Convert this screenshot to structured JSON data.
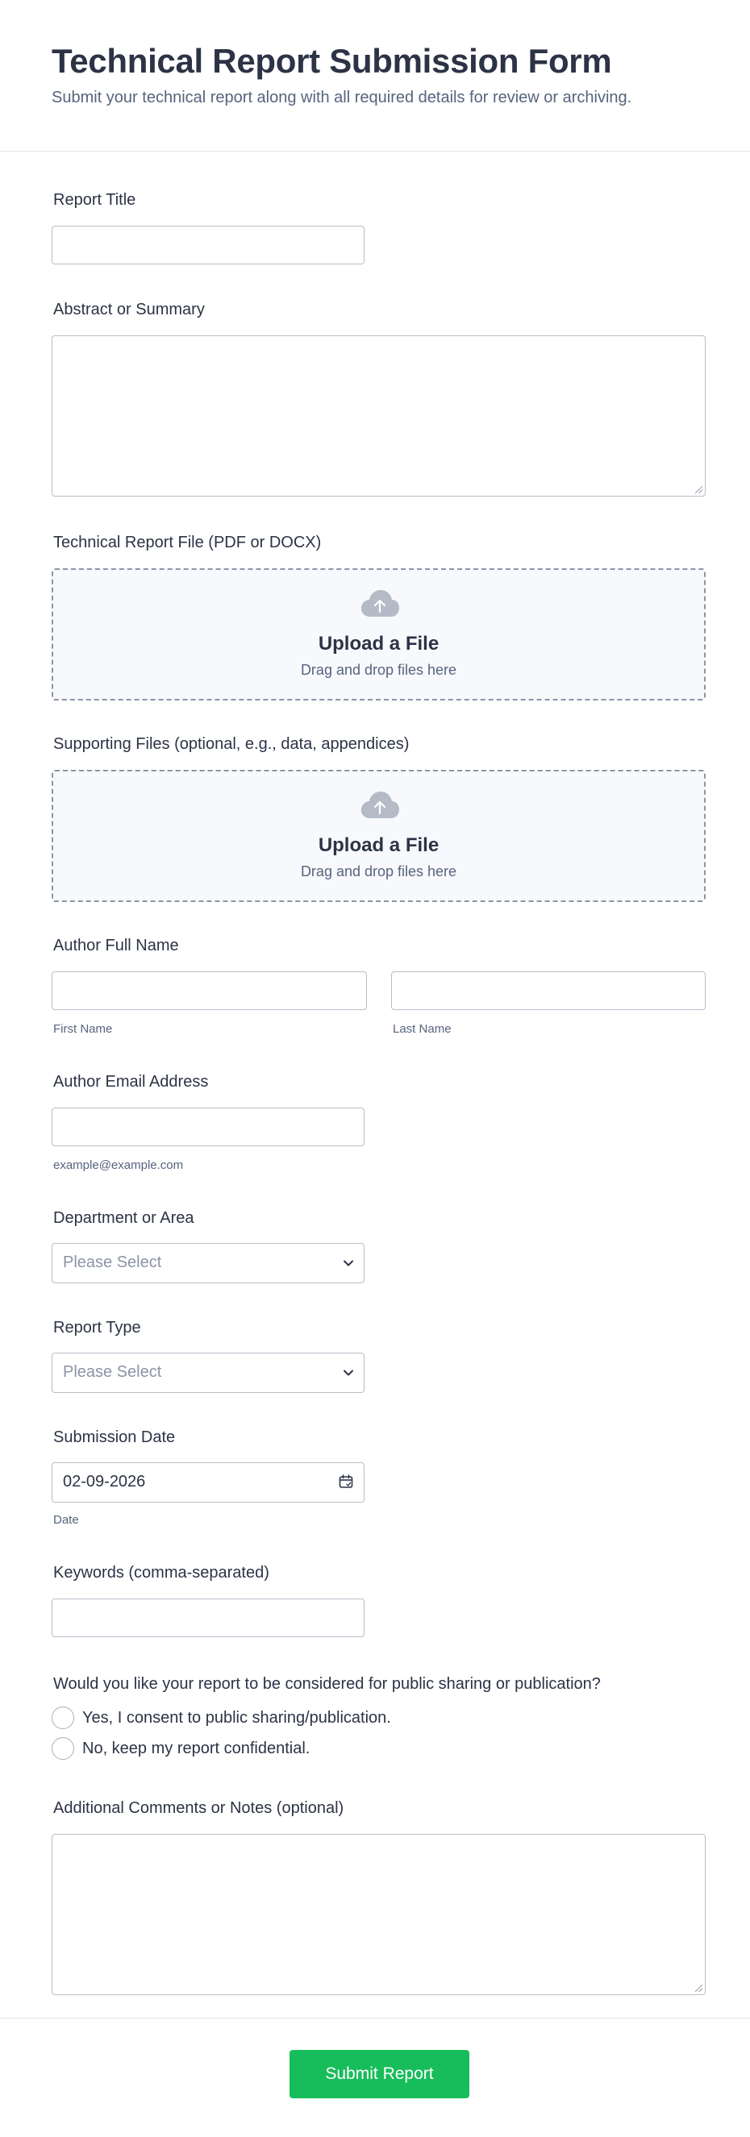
{
  "header": {
    "title": "Technical Report Submission Form",
    "subtitle": "Submit your technical report along with all required details for review or archiving."
  },
  "fields": {
    "report_title": {
      "label": "Report Title",
      "value": ""
    },
    "abstract": {
      "label": "Abstract or Summary",
      "value": ""
    },
    "report_file": {
      "label": "Technical Report File (PDF or DOCX)",
      "upload_title": "Upload a File",
      "upload_hint": "Drag and drop files here",
      "icon": "cloud-upload-icon"
    },
    "supporting_files": {
      "label": "Supporting Files (optional, e.g., data, appendices)",
      "upload_title": "Upload a File",
      "upload_hint": "Drag and drop files here",
      "icon": "cloud-upload-icon"
    },
    "author_name": {
      "label": "Author Full Name",
      "first_sublabel": "First Name",
      "last_sublabel": "Last Name",
      "first_value": "",
      "last_value": ""
    },
    "author_email": {
      "label": "Author Email Address",
      "sublabel": "example@example.com",
      "value": ""
    },
    "department": {
      "label": "Department or Area",
      "selected": "Please Select",
      "icon": "chevron-down-icon"
    },
    "report_type": {
      "label": "Report Type",
      "selected": "Please Select",
      "icon": "chevron-down-icon"
    },
    "submission_date": {
      "label": "Submission Date",
      "value": "02-09-2026",
      "sublabel": "Date",
      "icon": "calendar-icon"
    },
    "keywords": {
      "label": "Keywords (comma-separated)",
      "value": ""
    },
    "public_sharing": {
      "question": "Would you like your report to be considered for public sharing or publication?",
      "options": [
        "Yes, I consent to public sharing/publication.",
        "No, keep my report confidential."
      ]
    },
    "comments": {
      "label": "Additional Comments or Notes (optional)",
      "value": ""
    }
  },
  "footer": {
    "submit_label": "Submit Report"
  },
  "colors": {
    "accent": "#18bd5b",
    "text": "#2c3345",
    "muted": "#57647e",
    "border": "#b8bdc9",
    "upload_bg": "#f8f9fc"
  }
}
